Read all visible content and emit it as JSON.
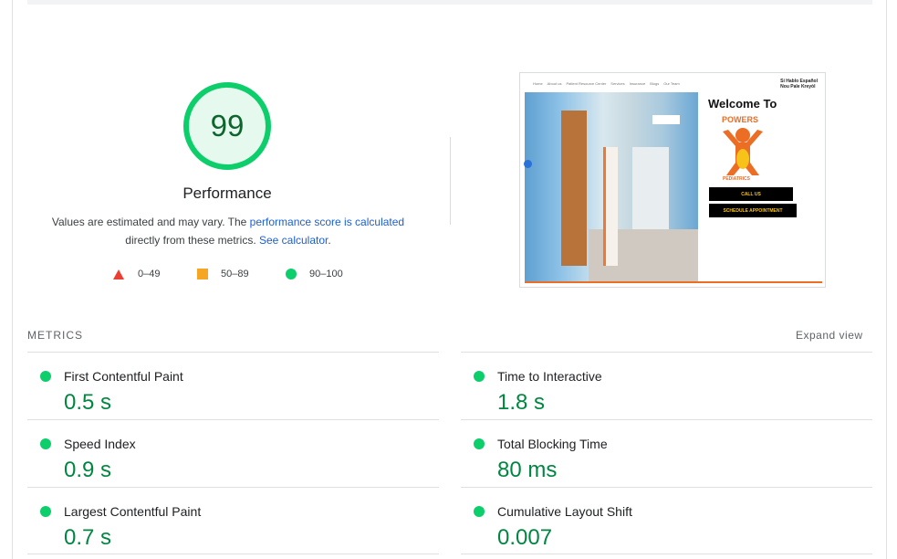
{
  "score": {
    "value": "99",
    "fraction": 0.99,
    "title": "Performance",
    "desc_prefix": "Values are estimated and may vary. The ",
    "desc_link1": "performance score is calculated",
    "desc_middle": " directly from these metrics. ",
    "desc_link2": "See calculator",
    "desc_suffix": "."
  },
  "legend": {
    "fail": "0–49",
    "average": "50–89",
    "pass": "90–100"
  },
  "screenshot": {
    "nav": [
      "Home",
      "About us",
      "Patient Resource Center",
      "Services",
      "Insurance",
      "Blogs",
      "Our Team"
    ],
    "lang_line1": "Sí Hablo Español",
    "lang_line2": "Nou Pale Kreyòl",
    "welcome": "Welcome To",
    "brand_top": "POWERS",
    "brand_bottom": "PEDIATRICS",
    "button1": "CALL US",
    "button2": "SCHEDULE APPOINTMENT",
    "accent_color": "#ec6d24"
  },
  "metrics": {
    "label": "METRICS",
    "expand": "Expand view",
    "items": [
      {
        "name": "First Contentful Paint",
        "value": "0.5 s"
      },
      {
        "name": "Time to Interactive",
        "value": "1.8 s"
      },
      {
        "name": "Speed Index",
        "value": "0.9 s"
      },
      {
        "name": "Total Blocking Time",
        "value": "80 ms"
      },
      {
        "name": "Largest Contentful Paint",
        "value": "0.7 s"
      },
      {
        "name": "Cumulative Layout Shift",
        "value": "0.007"
      }
    ]
  },
  "colors": {
    "pass": "#0cce6b",
    "average": "#f5a623",
    "fail": "#eb3f34",
    "score_text": "#0d652d",
    "metric_value": "#018642",
    "link": "#1a5fd6"
  }
}
